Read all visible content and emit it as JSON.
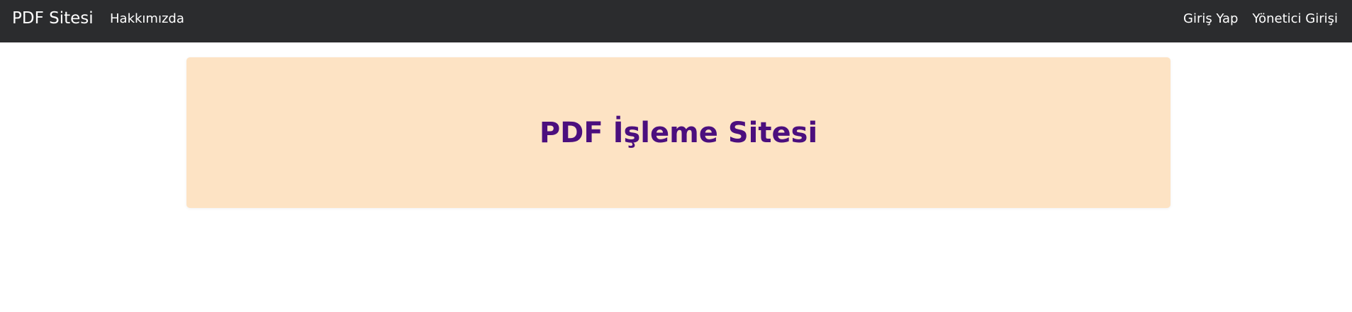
{
  "navbar": {
    "brand": "PDF Sitesi",
    "about_link": "Hakkımızda",
    "login_link": "Giriş Yap",
    "admin_login_link": "Yönetici Girişi"
  },
  "hero": {
    "title": "PDF İşleme Sitesi"
  },
  "colors": {
    "navbar_bg": "#2b2c2e",
    "hero_bg": "#fde3c4",
    "hero_title": "#4b0f7e"
  }
}
